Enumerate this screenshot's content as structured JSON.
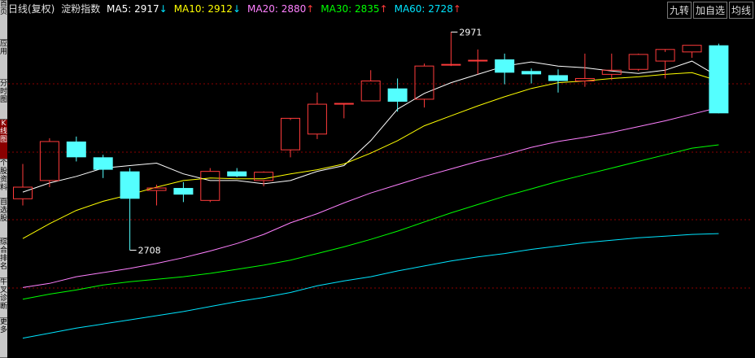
{
  "header": {
    "title": "日线(复权)",
    "index_name": "淀粉指数",
    "ma": [
      {
        "label": "MA5:",
        "value": "2917",
        "arrow": "↓",
        "dir": "down",
        "color": "#ffffff"
      },
      {
        "label": "MA10:",
        "value": "2912",
        "arrow": "↓",
        "dir": "down",
        "color": "#ffff00"
      },
      {
        "label": "MA20:",
        "value": "2880",
        "arrow": "↑",
        "dir": "up",
        "color": "#ff80ff"
      },
      {
        "label": "MA30:",
        "value": "2835",
        "arrow": "↑",
        "dir": "up",
        "color": "#00ff00"
      },
      {
        "label": "MA60:",
        "value": "2728",
        "arrow": "↑",
        "dir": "up",
        "color": "#00e5ff"
      }
    ]
  },
  "buttons": {
    "b1": "九转",
    "b2": "加自选",
    "b3": "均线"
  },
  "sidebar": {
    "tabs": [
      "首页",
      "应用",
      "分时图",
      "K线图",
      "个股资料",
      "自选股",
      "综合排名",
      "牛叉诊断",
      "更多"
    ],
    "active": 3
  },
  "colors": {
    "up": "#ff3b3b",
    "down": "#54ffff",
    "grid": "#8b0000",
    "background": "#000000"
  },
  "chart_data": {
    "type": "candlestick",
    "ylim": [
      2580,
      2990
    ],
    "candles": [
      {
        "o": 2770,
        "h": 2812,
        "l": 2762,
        "c": 2784
      },
      {
        "o": 2792,
        "h": 2843,
        "l": 2784,
        "c": 2839
      },
      {
        "o": 2839,
        "h": 2845,
        "l": 2815,
        "c": 2820
      },
      {
        "o": 2820,
        "h": 2823,
        "l": 2795,
        "c": 2805
      },
      {
        "o": 2803,
        "h": 2807,
        "l": 2708,
        "c": 2770
      },
      {
        "o": 2780,
        "h": 2787,
        "l": 2762,
        "c": 2783
      },
      {
        "o": 2783,
        "h": 2790,
        "l": 2766,
        "c": 2775
      },
      {
        "o": 2768,
        "h": 2807,
        "l": 2766,
        "c": 2803
      },
      {
        "o": 2803,
        "h": 2807,
        "l": 2796,
        "c": 2797
      },
      {
        "o": 2792,
        "h": 2803,
        "l": 2785,
        "c": 2802
      },
      {
        "o": 2829,
        "h": 2865,
        "l": 2820,
        "c": 2867
      },
      {
        "o": 2848,
        "h": 2898,
        "l": 2842,
        "c": 2884
      },
      {
        "o": 2884,
        "h": 2885,
        "l": 2867,
        "c": 2885
      },
      {
        "o": 2888,
        "h": 2925,
        "l": 2888,
        "c": 2912
      },
      {
        "o": 2903,
        "h": 2915,
        "l": 2875,
        "c": 2887
      },
      {
        "o": 2890,
        "h": 2933,
        "l": 2880,
        "c": 2930
      },
      {
        "o": 2932,
        "h": 2971,
        "l": 2930,
        "c": 2932
      },
      {
        "o": 2937,
        "h": 2950,
        "l": 2920,
        "c": 2937
      },
      {
        "o": 2938,
        "h": 2945,
        "l": 2908,
        "c": 2922
      },
      {
        "o": 2924,
        "h": 2927,
        "l": 2909,
        "c": 2920
      },
      {
        "o": 2919,
        "h": 2926,
        "l": 2898,
        "c": 2912
      },
      {
        "o": 2912,
        "h": 2945,
        "l": 2905,
        "c": 2915
      },
      {
        "o": 2920,
        "h": 2945,
        "l": 2913,
        "c": 2925
      },
      {
        "o": 2926,
        "h": 2945,
        "l": 2924,
        "c": 2944
      },
      {
        "o": 2936,
        "h": 2947,
        "l": 2915,
        "c": 2950
      },
      {
        "o": 2947,
        "h": 2955,
        "l": 2940,
        "c": 2955
      },
      {
        "o": 2955,
        "h": 2957,
        "l": 2873,
        "c": 2873
      }
    ],
    "ma_series": [
      {
        "name": "MA5",
        "color": "#ffffff",
        "values": [
          2778,
          2789,
          2797,
          2807,
          2810,
          2813,
          2800,
          2792,
          2792,
          2788,
          2792,
          2803,
          2810,
          2840,
          2878,
          2897,
          2910,
          2920,
          2930,
          2935,
          2930,
          2928,
          2924,
          2921,
          2925,
          2936,
          2917
        ]
      },
      {
        "name": "MA10",
        "color": "#ffff00",
        "values": [
          2722,
          2740,
          2756,
          2767,
          2775,
          2784,
          2792,
          2795,
          2794,
          2794,
          2800,
          2805,
          2812,
          2825,
          2840,
          2858,
          2870,
          2882,
          2893,
          2903,
          2910,
          2912,
          2915,
          2917,
          2920,
          2922,
          2912
        ]
      },
      {
        "name": "MA20",
        "color": "#ff80ff",
        "values": [
          2663,
          2668,
          2676,
          2681,
          2686,
          2692,
          2699,
          2707,
          2716,
          2727,
          2741,
          2752,
          2765,
          2777,
          2787,
          2797,
          2806,
          2815,
          2823,
          2832,
          2839,
          2844,
          2850,
          2857,
          2864,
          2872,
          2880
        ]
      },
      {
        "name": "MA30",
        "color": "#00ff00",
        "values": [
          2649,
          2655,
          2660,
          2666,
          2670,
          2673,
          2676,
          2680,
          2685,
          2690,
          2696,
          2704,
          2712,
          2721,
          2731,
          2742,
          2753,
          2763,
          2773,
          2782,
          2791,
          2799,
          2807,
          2815,
          2823,
          2831,
          2835
        ]
      },
      {
        "name": "MA60",
        "color": "#00e5ff",
        "values": [
          2602,
          2608,
          2614,
          2619,
          2624,
          2629,
          2634,
          2640,
          2646,
          2651,
          2657,
          2665,
          2671,
          2676,
          2683,
          2689,
          2695,
          2700,
          2704,
          2709,
          2713,
          2717,
          2720,
          2723,
          2725,
          2727,
          2728
        ]
      }
    ],
    "annotations": [
      {
        "text": "2971",
        "index": 16,
        "value": 2971
      },
      {
        "text": "2708",
        "index": 4,
        "value": 2708
      }
    ]
  }
}
